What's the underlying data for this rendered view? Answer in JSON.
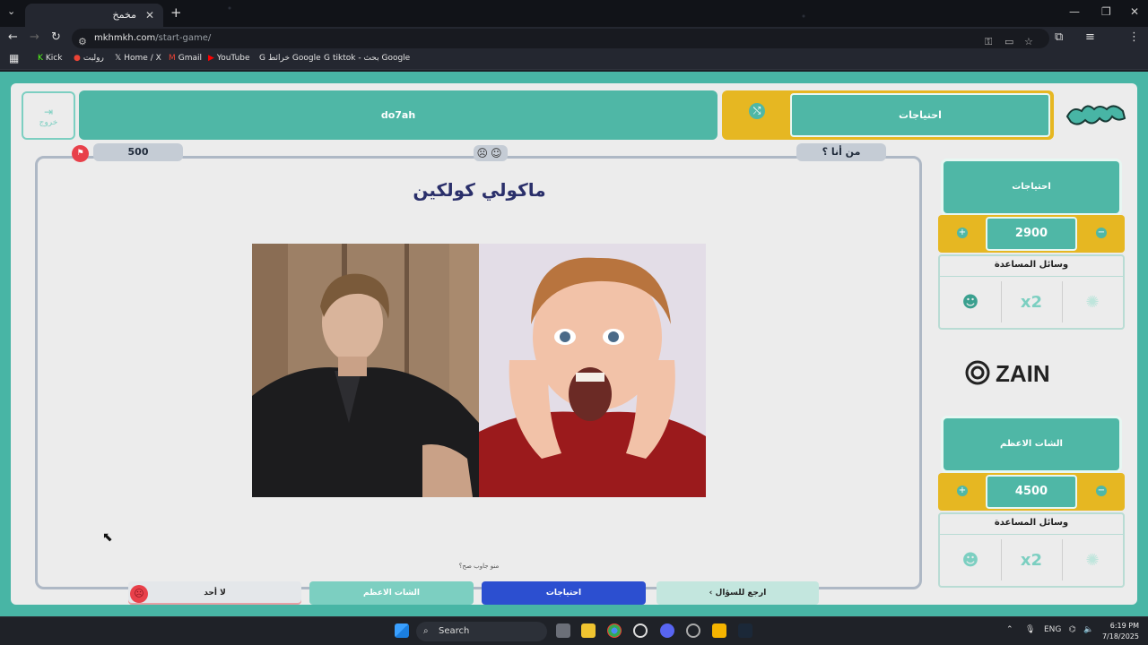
{
  "browser": {
    "tab_title": "مخمخ",
    "url_host": "mkhmkh.com",
    "url_path": "/start-game/",
    "bookmarks": [
      "Kick",
      "رولبت",
      "Home / X",
      "Gmail",
      "YouTube",
      "خرائط Google",
      "tiktok - بحث Google"
    ]
  },
  "game": {
    "exit_label": "خروج",
    "team_left_name": "do7ah",
    "team_right_name": "احتياجات",
    "points_pill": "500",
    "category_pill": "من أنا ؟",
    "faces": "☹☺",
    "question": "ماكولي كولكين",
    "answer_prompt": "منو جاوب صح؟",
    "bottom": {
      "none": "لا أحد",
      "team_a": "الشات الاعظم",
      "team_b": "احتياجات",
      "back": "ارجع للسؤال"
    }
  },
  "sidebar": {
    "team1": {
      "name": "احتياجات",
      "score": "2900",
      "help_label": "وسائل المساعدة"
    },
    "team2": {
      "name": "الشات الاعظم",
      "score": "4500",
      "help_label": "وسائل المساعدة"
    },
    "sponsor": "ZAIN"
  },
  "taskbar": {
    "search_label": "Search",
    "lang": "ENG",
    "time": "6:19 PM",
    "date": "7/18/2025"
  },
  "colors": {
    "teal": "#4fb7a6",
    "yellow": "#e6b722",
    "blue": "#2c4fd0",
    "red": "#e8404a"
  }
}
